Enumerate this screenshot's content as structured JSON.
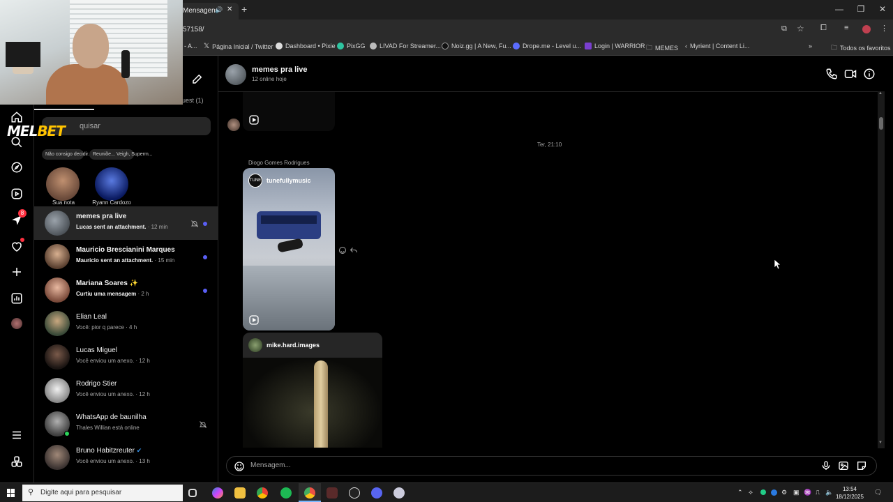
{
  "browser": {
    "tab_title": "Mensagens",
    "url_fragment": "57158/",
    "bookmarks": [
      {
        "label": "- A..."
      },
      {
        "label": "Página Inicial / Twitter"
      },
      {
        "label": "Dashboard • Pixie"
      },
      {
        "label": "PixGG"
      },
      {
        "label": "LIVAD For Streamer..."
      },
      {
        "label": "Noiz.gg | A New, Fu..."
      },
      {
        "label": "Drope.me - Level u..."
      },
      {
        "label": "Login | WARRIOR"
      },
      {
        "label": "MEMES"
      },
      {
        "label": "Myrient | Content Li..."
      }
    ],
    "all_favorites": "Todos os favoritos"
  },
  "overlay": {
    "logo_mel": "MEL",
    "logo_bet": "BET"
  },
  "rail": {
    "messages_badge": "8"
  },
  "sidebar": {
    "request_label": "uest (1)",
    "search_placeholder": "quisar",
    "notes": [
      {
        "bubble": "Não consigo decidir...",
        "label": "Sua nota"
      },
      {
        "bubble": "Reuniõe... Veigh, Superm...",
        "label": "Ryann Cardozo"
      }
    ],
    "conversations": [
      {
        "name": "memes pra live",
        "preview": "Lucas sent an attachment.",
        "time": "· 12 min",
        "unread": true,
        "muted": true,
        "active": true
      },
      {
        "name": "Mauricio Brescianini Marques",
        "preview": "Mauricio sent an attachment.",
        "time": "· 15 min",
        "unread": true
      },
      {
        "name": "Mariana Soares ✨",
        "preview": "Curtiu uma mensagem",
        "time": "· 2 h",
        "unread": true
      },
      {
        "name": "Elian Leal",
        "preview": "Você: pior q parece",
        "time": "· 4 h"
      },
      {
        "name": "Lucas Miguel",
        "preview": "Você enviou um anexo.",
        "time": "· 12 h"
      },
      {
        "name": "Rodrigo Stier",
        "preview": "Você enviou um anexo.",
        "time": "· 12 h"
      },
      {
        "name": "WhatsApp de baunilha",
        "preview": "Thales Willian está online",
        "time": "",
        "muted": true
      },
      {
        "name": "Bruno Habitzreuter",
        "preview": "Você enviou um anexo.",
        "time": "· 13 h"
      }
    ]
  },
  "chat": {
    "title": "memes pra live",
    "subtitle": "12 online hoje",
    "timestamp": "Ter, 21:10",
    "sender": "Diogo Gomes Rodrigues",
    "reel_account": "tunefullymusic",
    "post_account": "mike.hard.images",
    "composer_placeholder": "Mensagem..."
  },
  "taskbar": {
    "search_placeholder": "Digite aqui para pesquisar",
    "time": "13:54",
    "date": "18/12/2025"
  }
}
